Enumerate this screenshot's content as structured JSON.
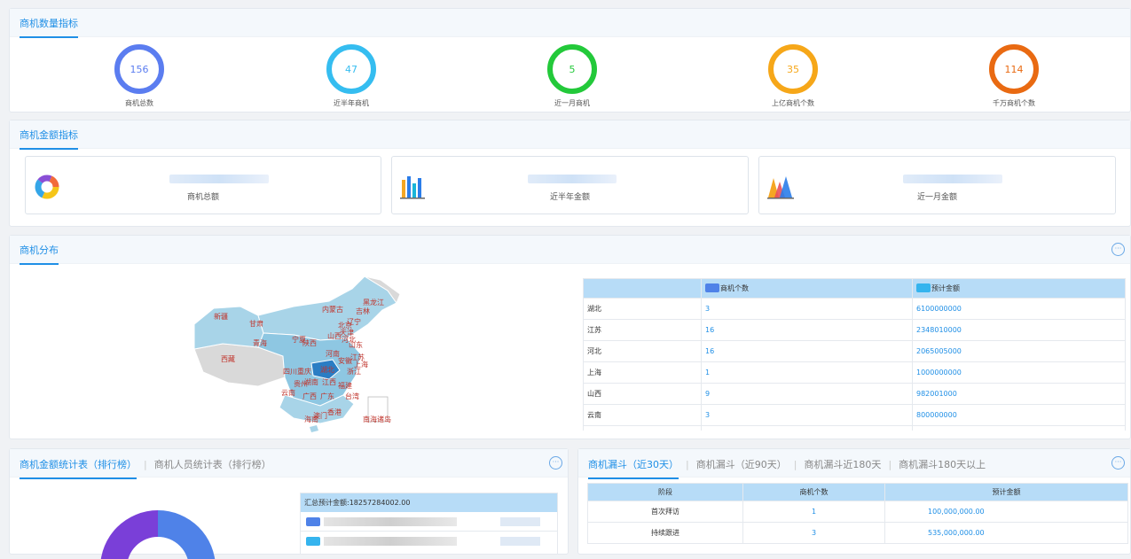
{
  "count_panel": {
    "title": "商机数量指标",
    "kpis": [
      {
        "value": "156",
        "label": "商机总数",
        "color": "#5b7df0"
      },
      {
        "value": "47",
        "label": "近半年商机",
        "color": "#35bdf0"
      },
      {
        "value": "5",
        "label": "近一月商机",
        "color": "#23c93a"
      },
      {
        "value": "35",
        "label": "上亿商机个数",
        "color": "#f6a719"
      },
      {
        "value": "114",
        "label": "千万商机个数",
        "color": "#e96a12"
      }
    ]
  },
  "amount_panel": {
    "title": "商机金额指标",
    "cards": [
      {
        "label": "商机总额",
        "icon": "donut-chart-icon"
      },
      {
        "label": "近半年金额",
        "icon": "bar-chart-icon"
      },
      {
        "label": "近一月金额",
        "icon": "area-chart-icon"
      }
    ]
  },
  "distribution_panel": {
    "title": "商机分布",
    "map_labels": [
      "新疆",
      "西藏",
      "甘肃",
      "青海",
      "内蒙古",
      "黑龙江",
      "吉林",
      "辽宁",
      "北京",
      "天津",
      "河北",
      "山西",
      "陕西",
      "宁夏",
      "山东",
      "河南",
      "江苏",
      "安徽",
      "上海",
      "浙江",
      "湖北",
      "四川",
      "重庆",
      "贵州",
      "湖南",
      "江西",
      "福建",
      "云南",
      "广西",
      "广东",
      "台湾",
      "海南",
      "澳门",
      "香港",
      "南海诸岛"
    ],
    "table": {
      "headers": [
        "",
        "商机个数",
        "预计金额"
      ],
      "legend_colors": [
        "#4f82e8",
        "#35b4ee"
      ],
      "rows": [
        {
          "region": "湖北",
          "count": "3",
          "amount": "6100000000"
        },
        {
          "region": "江苏",
          "count": "16",
          "amount": "2348010000"
        },
        {
          "region": "河北",
          "count": "16",
          "amount": "2065005000"
        },
        {
          "region": "上海",
          "count": "1",
          "amount": "1000000000"
        },
        {
          "region": "山西",
          "count": "9",
          "amount": "982001000"
        },
        {
          "region": "云南",
          "count": "3",
          "amount": "800000000"
        }
      ]
    }
  },
  "ranking_panel": {
    "tabs": [
      "商机金额统计表（排行榜）",
      "商机人员统计表（排行榜）"
    ],
    "summary": "汇总预计金额:18257284002.00",
    "legend_colors": [
      "#4f82e8",
      "#35b4ee"
    ],
    "donut_colors": [
      "#4f82e8",
      "#7a3fd8"
    ]
  },
  "funnel_panel": {
    "tabs": [
      "商机漏斗（近30天）",
      "商机漏斗（近90天）",
      "商机漏斗近180天",
      "商机漏斗180天以上"
    ],
    "headers": [
      "阶段",
      "商机个数",
      "预计金额"
    ],
    "rows": [
      {
        "stage": "首次拜访",
        "count": "1",
        "amount": "100,000,000.00"
      },
      {
        "stage": "持续跟进",
        "count": "3",
        "amount": "535,000,000.00"
      }
    ]
  }
}
